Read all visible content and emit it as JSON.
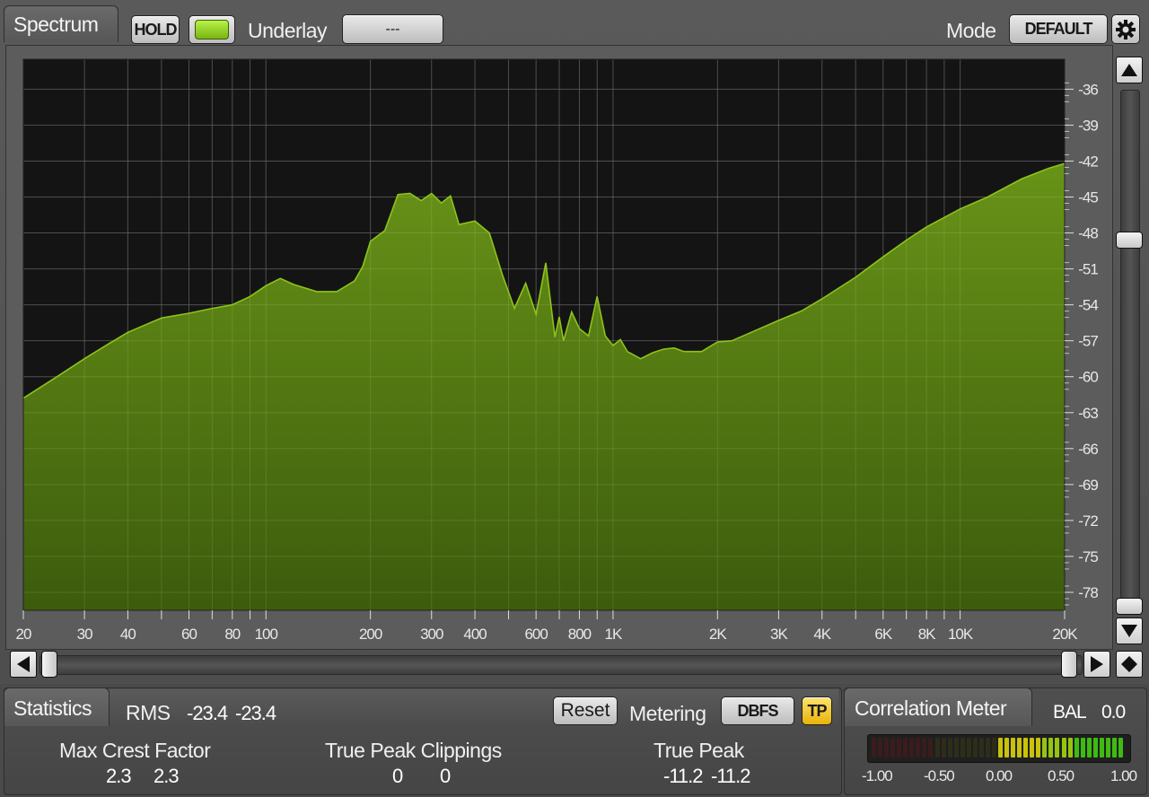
{
  "spectrum": {
    "tab_label": "Spectrum",
    "hold_label": "HOLD",
    "underlay_label": "Underlay",
    "underlay_value": "---",
    "mode_label": "Mode",
    "mode_value": "DEFAULT",
    "accent": "#8ec31a",
    "fill_color": "#5f8a14"
  },
  "chart_data": {
    "type": "area",
    "title": "",
    "xlabel": "",
    "ylabel": "",
    "x_scale": "log",
    "xlim": [
      20,
      20000
    ],
    "ylim": [
      -79.5,
      -33.5
    ],
    "x_tick_labels": [
      "20",
      "30",
      "40",
      "60",
      "80",
      "100",
      "200",
      "300",
      "400",
      "600",
      "800",
      "1K",
      "2K",
      "3K",
      "4K",
      "6K",
      "8K",
      "10K",
      "20K"
    ],
    "x_tick_values": [
      20,
      30,
      40,
      60,
      80,
      100,
      200,
      300,
      400,
      600,
      800,
      1000,
      2000,
      3000,
      4000,
      6000,
      8000,
      10000,
      20000
    ],
    "y_ticks": [
      -36,
      -39,
      -42,
      -45,
      -48,
      -51,
      -54,
      -57,
      -60,
      -63,
      -66,
      -69,
      -72,
      -75,
      -78
    ],
    "grid": true,
    "series": [
      {
        "x": [
          20,
          25,
          30,
          35,
          40,
          50,
          60,
          70,
          80,
          90,
          100,
          110,
          120,
          140,
          160,
          180,
          190,
          200,
          220,
          240,
          260,
          280,
          300,
          320,
          340,
          360,
          400,
          440,
          480,
          520,
          560,
          600,
          640,
          680,
          700,
          720,
          760,
          800,
          850,
          900,
          950,
          1000,
          1050,
          1100,
          1200,
          1300,
          1400,
          1500,
          1600,
          1800,
          2000,
          2200,
          2500,
          3000,
          3500,
          4000,
          5000,
          6000,
          7000,
          8000,
          10000,
          12000,
          15000,
          18000,
          20000
        ],
        "values": [
          -61.8,
          -60.0,
          -58.5,
          -57.3,
          -56.3,
          -55.1,
          -54.7,
          -54.3,
          -54.0,
          -53.3,
          -52.4,
          -51.8,
          -52.3,
          -52.9,
          -52.9,
          -52.0,
          -50.8,
          -48.7,
          -47.8,
          -44.8,
          -44.7,
          -45.3,
          -44.7,
          -45.5,
          -44.9,
          -47.3,
          -47.0,
          -48.0,
          -51.5,
          -54.3,
          -52.2,
          -54.8,
          -50.5,
          -56.7,
          -55.0,
          -57.0,
          -54.6,
          -56.0,
          -56.6,
          -53.3,
          -56.6,
          -57.4,
          -56.9,
          -57.9,
          -58.5,
          -58.0,
          -57.7,
          -57.6,
          -57.9,
          -57.9,
          -57.1,
          -57.0,
          -56.3,
          -55.3,
          -54.5,
          -53.5,
          -51.7,
          -50.0,
          -48.6,
          -47.5,
          -46.0,
          -45.0,
          -43.5,
          -42.6,
          -42.2
        ]
      }
    ]
  },
  "statistics": {
    "tab_label": "Statistics",
    "rms_label": "RMS",
    "rms_left": "-23.4",
    "rms_right": "-23.4",
    "reset_label": "Reset",
    "metering_label": "Metering",
    "metering_value": "DBFS",
    "tp_label": "TP",
    "max_crest_label": "Max Crest Factor",
    "max_crest_left": "2.3",
    "max_crest_right": "2.3",
    "tp_clip_label": "True Peak Clippings",
    "tp_clip_left": "0",
    "tp_clip_right": "0",
    "true_peak_label": "True Peak",
    "true_peak_left": "-11.2",
    "true_peak_right": "-11.2"
  },
  "correlation": {
    "tab_label": "Correlation Meter",
    "bal_label": "BAL",
    "bal_value": "0.0",
    "scale": [
      "-1.00",
      "-0.50",
      "0.00",
      "0.50",
      "1.00"
    ],
    "active_from": 0.0,
    "active_to": 1.0
  },
  "icons": {
    "gear": "gear-icon",
    "up": "triangle-up-icon",
    "down": "triangle-down-icon",
    "left": "triangle-left-icon",
    "right": "triangle-right-icon",
    "fit": "diamond-icon"
  }
}
